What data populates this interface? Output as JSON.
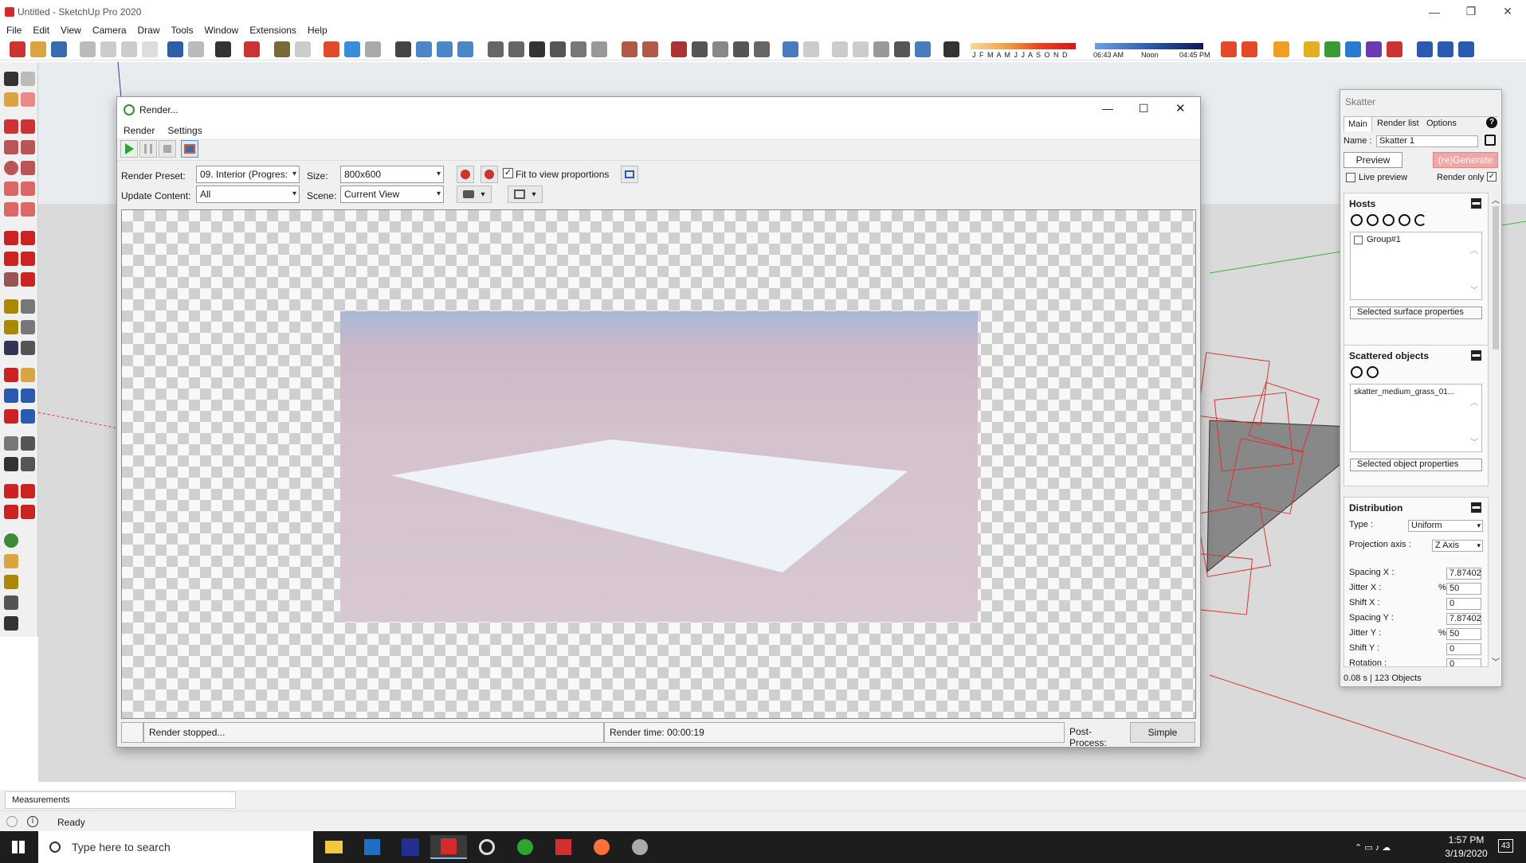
{
  "app": {
    "title": "Untitled - SketchUp Pro 2020",
    "minimize": "—",
    "restore": "❐",
    "close": "✕"
  },
  "menu": [
    "File",
    "Edit",
    "View",
    "Camera",
    "Draw",
    "Tools",
    "Window",
    "Extensions",
    "Help"
  ],
  "shadow": {
    "months": "J F M A M J J A S O N D",
    "time_start": "06:43 AM",
    "time_mid": "Noon",
    "time_end": "04:45 PM"
  },
  "render_dialog": {
    "title": "Render...",
    "menu": [
      "Render",
      "Settings"
    ],
    "preset_label": "Render Preset:",
    "preset_value": "09. Interior (Progres:",
    "size_label": "Size:",
    "size_value": "800x600",
    "fit_label": "Fit to view proportions",
    "fit_checked": true,
    "update_label": "Update Content:",
    "update_value": "All",
    "scene_label": "Scene:",
    "scene_value": "Current View",
    "status": "Render stopped...",
    "render_time": "Render time: 00:00:19",
    "postprocess_label": "Post-Process:",
    "postprocess_value": "Simple"
  },
  "skatter": {
    "title": "Skatter",
    "tabs": [
      "Main",
      "Render list",
      "Options"
    ],
    "help": "?",
    "name_label": "Name :",
    "name_value": "Skatter 1",
    "preview": "Preview",
    "generate": "(re)Generate",
    "live_preview": "Live preview",
    "render_only": "Render only",
    "hosts": {
      "title": "Hosts",
      "items": [
        "Group#1"
      ],
      "props": "Selected surface properties"
    },
    "scattered": {
      "title": "Scattered objects",
      "items": [
        "skatter_medium_grass_01..."
      ],
      "props": "Selected object properties"
    },
    "distribution": {
      "title": "Distribution",
      "type_label": "Type :",
      "type_value": "Uniform",
      "proj_label": "Projection axis :",
      "proj_value": "Z Axis",
      "fields": [
        {
          "label": "Spacing X :",
          "unit": "",
          "value": "7.87402"
        },
        {
          "label": "Jitter X :",
          "unit": "%",
          "value": "50"
        },
        {
          "label": "Shift X :",
          "unit": "",
          "value": "0"
        },
        {
          "label": "Spacing Y :",
          "unit": "",
          "value": "7.87402"
        },
        {
          "label": "Jitter Y :",
          "unit": "%",
          "value": "50"
        },
        {
          "label": "Shift Y :",
          "unit": "",
          "value": "0"
        },
        {
          "label": "Rotation :",
          "unit": "",
          "value": "0"
        }
      ]
    },
    "footer": "0.08 s | 123 Objects"
  },
  "measurements": "Measurements",
  "status": "Ready",
  "taskbar": {
    "search_placeholder": "Type here to search",
    "time": "1:57 PM",
    "date": "3/19/2020",
    "notif": "43"
  }
}
